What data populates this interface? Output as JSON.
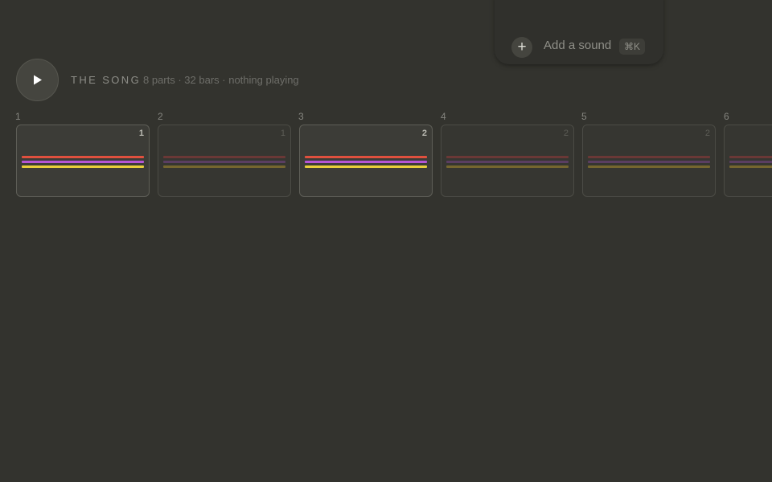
{
  "add_sound": {
    "plus": "+",
    "label": "Add a sound",
    "shortcut": "⌘K"
  },
  "header": {
    "play_icon": "play-icon",
    "title": "THE SONG",
    "meta": "8 parts · 32 bars · nothing playing"
  },
  "colors": {
    "track_red": "#e0503e",
    "track_purple": "#b455d6",
    "track_yellow": "#e8cf3a",
    "track_red_dim": "#6a3836",
    "track_purple_dim": "#5a3e62",
    "track_yellow_dim": "#75662f"
  },
  "parts": [
    {
      "number": "1",
      "badge": "1",
      "active": true
    },
    {
      "number": "2",
      "badge": "1",
      "active": false
    },
    {
      "number": "3",
      "badge": "2",
      "active": true
    },
    {
      "number": "4",
      "badge": "2",
      "active": false
    },
    {
      "number": "5",
      "badge": "2",
      "active": false
    },
    {
      "number": "6",
      "badge": "",
      "active": false
    }
  ]
}
